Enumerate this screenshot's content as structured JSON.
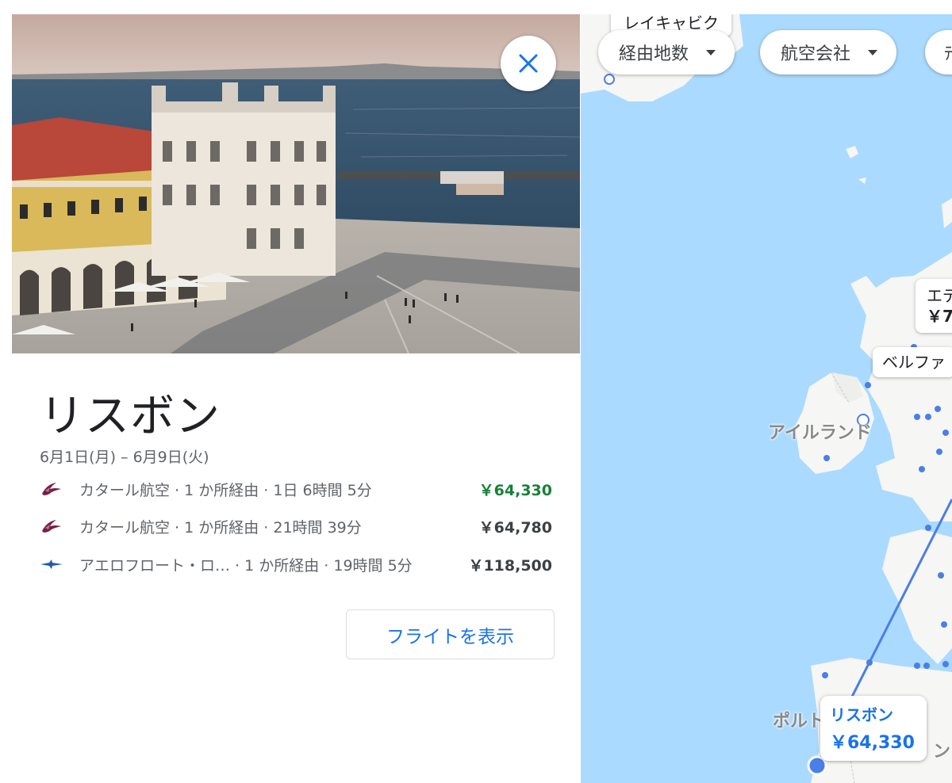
{
  "destination": {
    "city": "リスボン",
    "dates": "6月1日(月) – 6月9日(火)",
    "flights": [
      {
        "airline_icon": "qatar-airways-logo",
        "info": "カタール航空 · 1 か所経由 · 1日 6時間 5分",
        "price": "￥64,330",
        "cheapest": true
      },
      {
        "airline_icon": "qatar-airways-logo",
        "info": "カタール航空 · 1 か所経由 · 21時間 39分",
        "price": "￥64,780",
        "cheapest": false
      },
      {
        "airline_icon": "aeroflot-logo",
        "info": "アエロフロート・ロ… · 1 か所経由 · 19時間 5分",
        "price": "￥118,500",
        "cheapest": false
      }
    ],
    "show_flights_label": "フライトを表示",
    "close_icon": "close-icon"
  },
  "filters": [
    {
      "label": "経由地数"
    },
    {
      "label": "航空会社"
    },
    {
      "label": "ﾃ"
    }
  ],
  "map": {
    "top_label": "レイキャビク",
    "edinburgh_label": "エデ",
    "edinburgh_price": "￥7",
    "belfast_label": "ベルファ",
    "ireland_label": "アイルランド",
    "portugal_label": "ポルト",
    "spain_fragment": "ン",
    "lisbon_card": {
      "name": "リスボン",
      "price": "￥64,330"
    }
  },
  "colors": {
    "cheap_price": "#188038",
    "accent": "#1a73e8",
    "water": "#aadaff",
    "land": "#f6f6f4"
  }
}
